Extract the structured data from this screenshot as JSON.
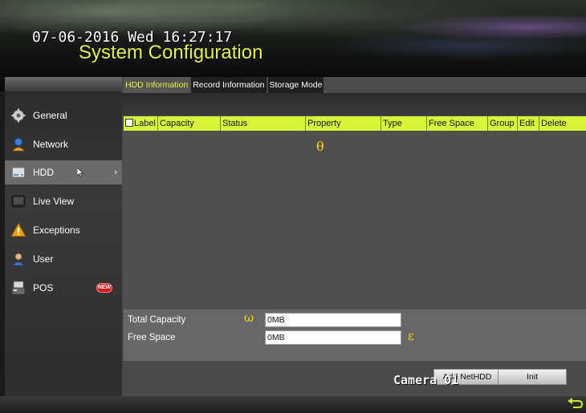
{
  "header": {
    "datetime": "07-06-2016 Wed 16:27:17",
    "title": "System Configuration"
  },
  "sidebar": {
    "items": [
      {
        "label": "General",
        "icon": "gear-icon"
      },
      {
        "label": "Network",
        "icon": "network-user-icon"
      },
      {
        "label": "HDD",
        "icon": "hdd-icon",
        "active": true,
        "arrow": "›"
      },
      {
        "label": "Live View",
        "icon": "monitor-icon"
      },
      {
        "label": "Exceptions",
        "icon": "warning-icon"
      },
      {
        "label": "User",
        "icon": "user-icon"
      },
      {
        "label": "POS",
        "icon": "pos-icon",
        "badge": "NEW"
      }
    ]
  },
  "tabs": [
    {
      "label": "HDD Information",
      "active": true
    },
    {
      "label": "Record Information",
      "active": false
    },
    {
      "label": "Storage Mode",
      "active": false
    }
  ],
  "table": {
    "columns": [
      "Label",
      "Capacity",
      "Status",
      "Property",
      "Type",
      "Free Space",
      "Group",
      "Edit",
      "Delete"
    ],
    "overlay_symbol": "θ",
    "rows": []
  },
  "summary": {
    "total_capacity_label": "Total Capacity",
    "total_capacity_value": "0MB",
    "free_space_label": "Free Space",
    "free_space_value": "0MB",
    "omega_symbol": "ω",
    "epsilon_symbol": "ε"
  },
  "buttons": {
    "add_nethdd": "Add NetHDD",
    "init": "Init"
  },
  "osd": {
    "camera": "Camera 01"
  },
  "colors": {
    "accent": "#e6f23a",
    "table_header": "#d9f53a",
    "badge": "#d21a1a",
    "overlay_symbols": "#ffd400"
  }
}
